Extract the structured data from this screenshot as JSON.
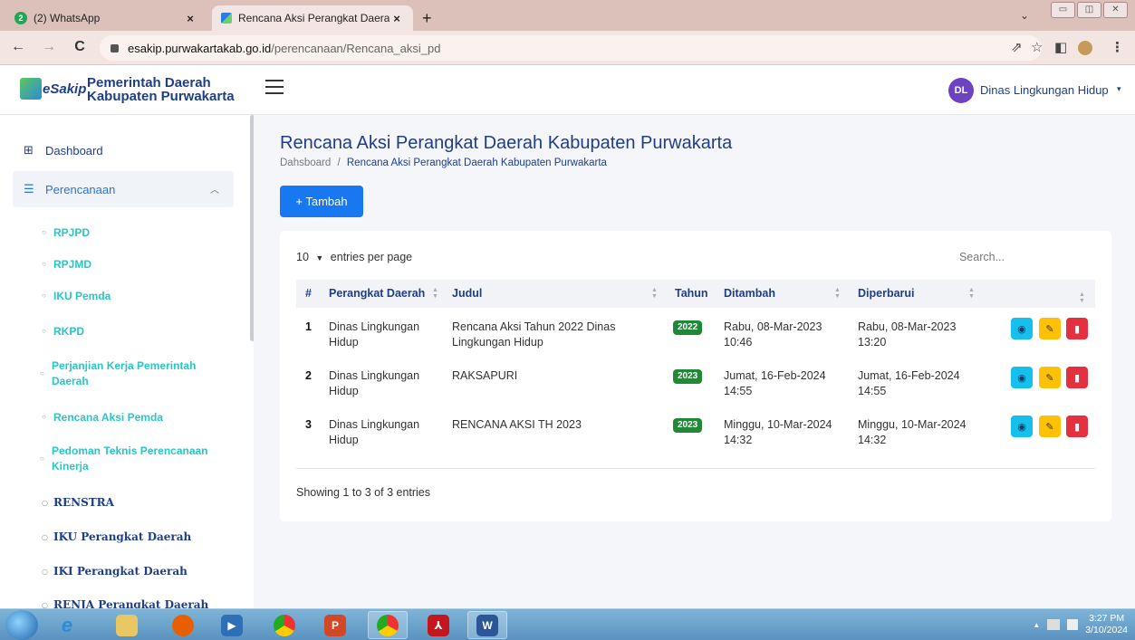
{
  "browser": {
    "tabs": [
      {
        "badge": "2",
        "label": "(2) WhatsApp",
        "close": "×"
      },
      {
        "label": "Rencana Aksi Perangkat Daerah I",
        "close": "×"
      }
    ],
    "new_tab": "+",
    "url_host": "esakip.purwakartakab.go.id",
    "url_path": "/perencanaan/Rencana_aksi_pd",
    "back": "←",
    "forward": "→",
    "reload": "C",
    "share": "⇗",
    "star": "☆",
    "sidepanel": "◧",
    "menu": "⋮",
    "minimize": "▭",
    "maximize": "◫",
    "close": "✕",
    "tab_menu": "⌄"
  },
  "header": {
    "logo": "eSakip",
    "org_line1": "Pemerintah Daerah",
    "org_line2": "Kabupaten Purwakarta",
    "avatar": "DL",
    "user": "Dinas Lingkungan Hidup",
    "caret": "▾"
  },
  "sidebar": {
    "dashboard": "Dashboard",
    "perencanaan": "Perencanaan",
    "items": [
      {
        "line1": "RPJPD"
      },
      {
        "line1": "RPJMD"
      },
      {
        "line1": "IKU Pemda"
      },
      {
        "line1": "RKPD"
      },
      {
        "line1": "Perjanjian Kerja Pemerintah",
        "line2": "Daerah"
      },
      {
        "line1": "Rencana Aksi Pemda"
      },
      {
        "line1": "Pedoman Teknis Perencanaan",
        "line2": "Kinerja"
      },
      {
        "line1": "RENSTRA"
      },
      {
        "line1": "IKU Perangkat Daerah"
      },
      {
        "line1": "IKI Perangkat Daerah"
      },
      {
        "line1": "RENJA Perangkat Daerah"
      }
    ]
  },
  "main": {
    "title": "Rencana Aksi Perangkat Daerah Kabupaten Purwakarta",
    "breadcrumb_home": "Dahsboard",
    "breadcrumb_sep": "/",
    "breadcrumb_current": "Rencana Aksi Perangkat Daerah Kabupaten Purwakarta",
    "add_button": "+ Tambah",
    "entries_count": "10",
    "entries_label": "entries per page",
    "search_placeholder": "Search...",
    "columns": [
      "#",
      "Perangkat Daerah",
      "Judul",
      "Tahun",
      "Ditambah",
      "Diperbarui"
    ],
    "rows": [
      {
        "no": "1",
        "pd1": "Dinas Lingkungan",
        "pd2": "Hidup",
        "judul1": "Rencana Aksi Tahun 2022 Dinas",
        "judul2": "Lingkungan Hidup",
        "tahun": "2022",
        "add1": "Rabu, 08-Mar-2023",
        "add2": "10:46",
        "upd1": "Rabu, 08-Mar-2023",
        "upd2": "13:20"
      },
      {
        "no": "2",
        "pd1": "Dinas Lingkungan",
        "pd2": "Hidup",
        "judul1": "RAKSAPURI",
        "judul2": "",
        "tahun": "2023",
        "add1": "Jumat, 16-Feb-2024",
        "add2": "14:55",
        "upd1": "Jumat, 16-Feb-2024",
        "upd2": "14:55"
      },
      {
        "no": "3",
        "pd1": "Dinas Lingkungan",
        "pd2": "Hidup",
        "judul1": "RENCANA AKSI TH 2023",
        "judul2": "",
        "tahun": "2023",
        "add1": "Minggu, 10-Mar-2024",
        "add2": "14:32",
        "upd1": "Minggu, 10-Mar-2024",
        "upd2": "14:32"
      }
    ],
    "showing": "Showing 1 to 3 of 3 entries"
  },
  "taskbar": {
    "time": "3:27 PM",
    "date": "3/10/2024",
    "tray_arrow": "▲"
  },
  "colors": {
    "primary": "#1778f2",
    "brand_text": "#1f3e8a",
    "accent_teal": "#2bc5c5",
    "badge_green": "#218838",
    "view": "#15c1ec",
    "edit": "#ffc107",
    "delete": "#e5313f"
  }
}
